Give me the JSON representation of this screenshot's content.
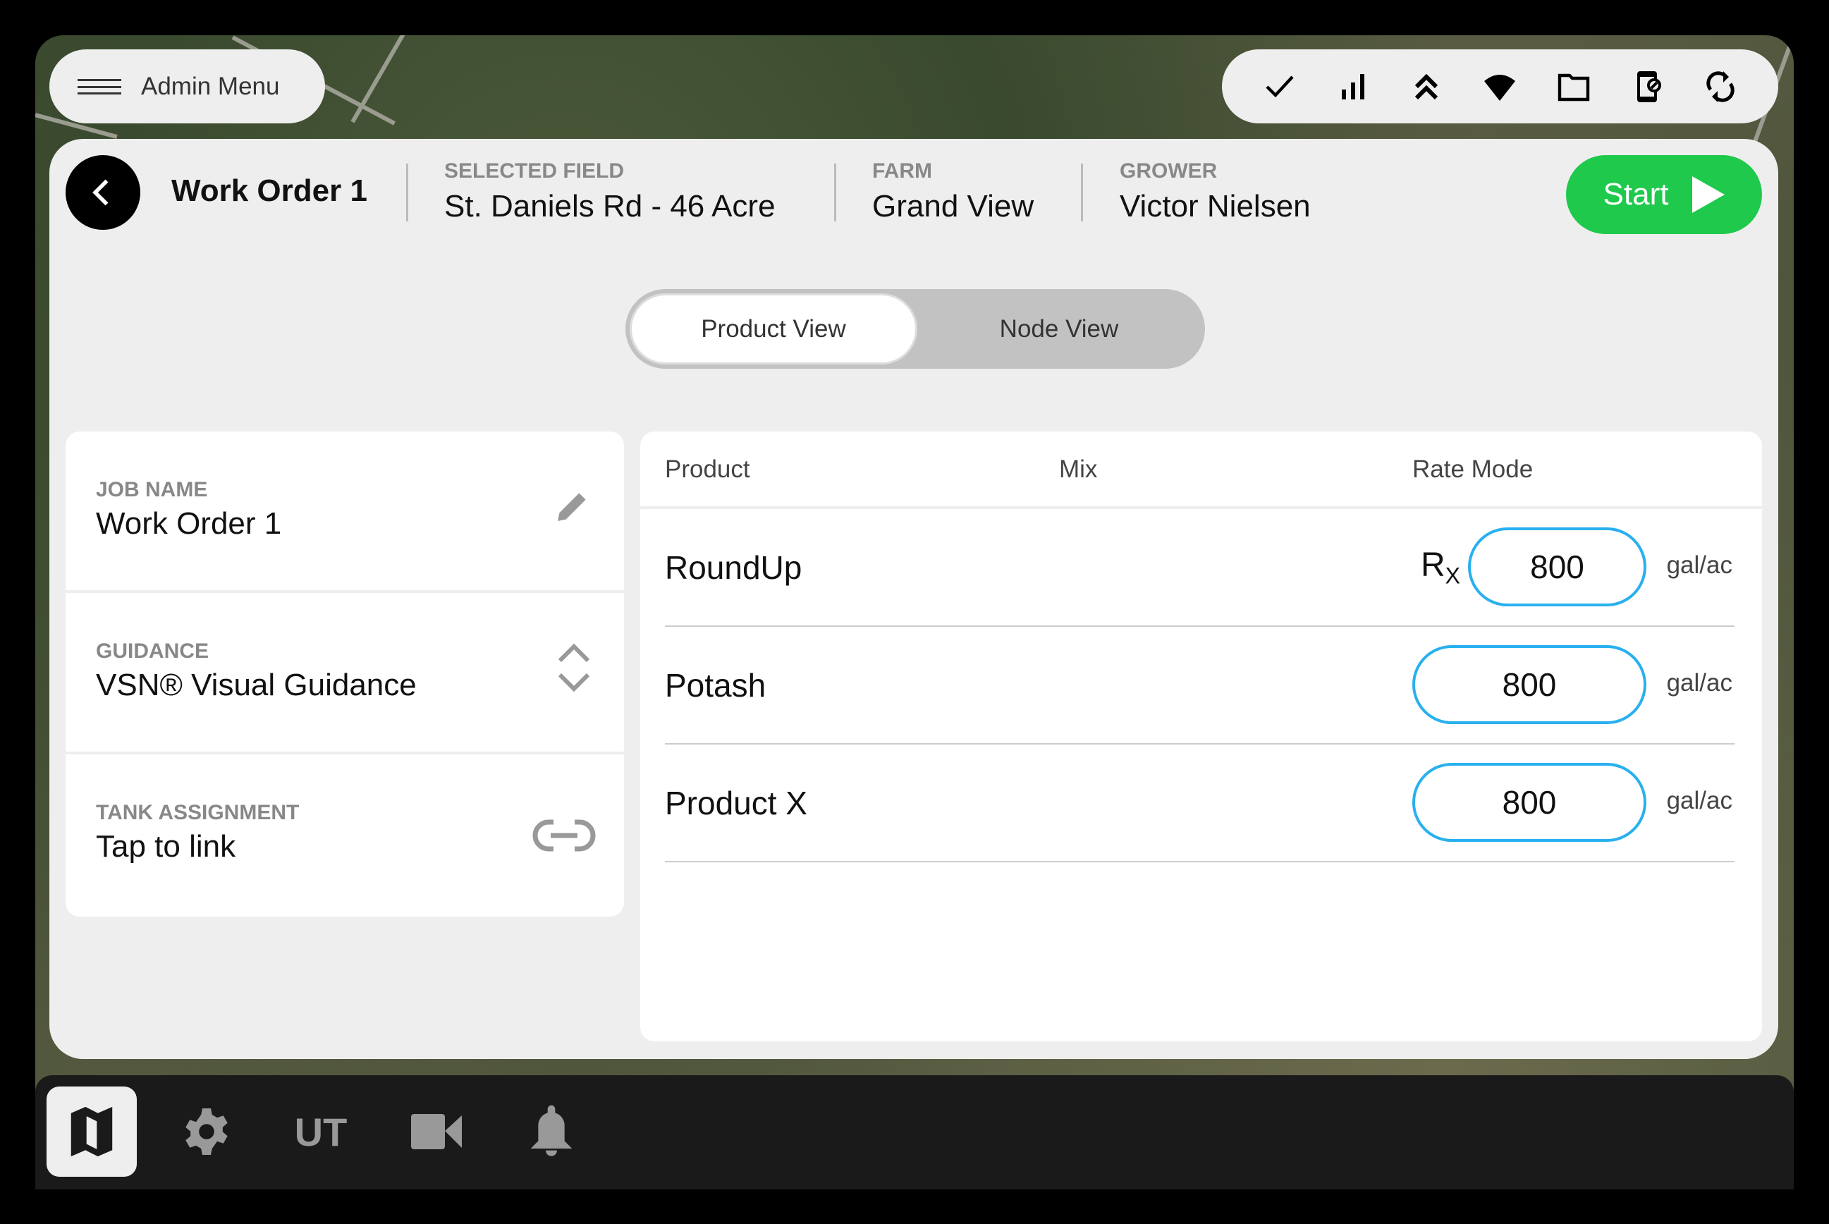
{
  "admin_menu": {
    "label": "Admin Menu"
  },
  "status_icons": [
    "check-icon",
    "signal-bars-icon",
    "double-chevron-up-icon",
    "wifi-icon",
    "folder-icon",
    "phone-blocked-icon",
    "sync-icon"
  ],
  "header": {
    "title": "Work Order 1",
    "fields": [
      {
        "label": "SELECTED FIELD",
        "value": "St. Daniels Rd - 46 Acre"
      },
      {
        "label": "FARM",
        "value": "Grand View"
      },
      {
        "label": "GROWER",
        "value": "Victor Nielsen"
      }
    ],
    "start_label": "Start"
  },
  "view_toggle": {
    "options": [
      "Product View",
      "Node View"
    ],
    "selected": "Product View"
  },
  "job": {
    "rows": [
      {
        "label": "JOB NAME",
        "value": "Work Order 1",
        "icon": "pencil-icon"
      },
      {
        "label": "GUIDANCE",
        "value": "VSN® Visual Guidance",
        "icon": "chevron-up-down-icon"
      },
      {
        "label": "TANK ASSIGNMENT",
        "value": "Tap to link",
        "icon": "link-icon"
      }
    ]
  },
  "products": {
    "columns": [
      "Product",
      "Mix",
      "Rate Mode"
    ],
    "rx_label": "R",
    "rx_sub": "X",
    "rows": [
      {
        "name": "RoundUp",
        "rate": "800",
        "unit": "gal/ac",
        "prescription": true
      },
      {
        "name": "Potash",
        "rate": "800",
        "unit": "gal/ac",
        "prescription": false
      },
      {
        "name": "Product X",
        "rate": "800",
        "unit": "gal/ac",
        "prescription": false
      }
    ]
  },
  "bottom_nav": {
    "ut_label": "UT",
    "items": [
      "map-icon",
      "gear-icon",
      "ut",
      "video-camera-icon",
      "bell-icon"
    ],
    "active": "map-icon"
  },
  "colors": {
    "start": "#1ec94c",
    "rate_border": "#29b0ee"
  }
}
